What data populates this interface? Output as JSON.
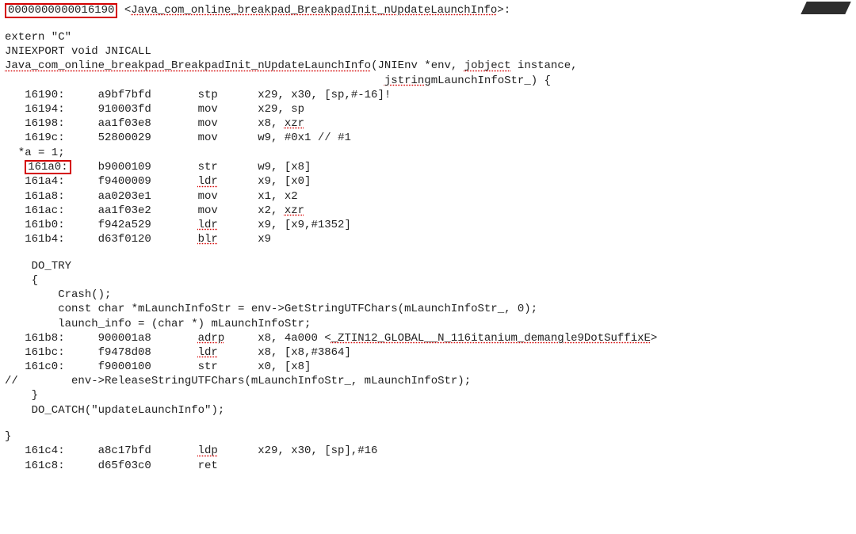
{
  "header": {
    "addr_boxed": "0000000000016190",
    "label_prefix": " <",
    "label": "Java_com_online_breakpad_BreakpadInit_nUpdateLaunchInfo",
    "label_suffix": ">:"
  },
  "decl": {
    "l1": "extern \"C\"",
    "l2": "JNIEXPORT void JNICALL",
    "fn": "Java_com_online_breakpad_BreakpadInit_nUpdateLaunchInfo",
    "args1_pre": "(JNIEnv *env, ",
    "args1_j": "jobject",
    "args1_post": " instance,",
    "args2_pre_spaces": "                                                         ",
    "args2_j": "jstring",
    "args2_post": " mLaunchInfoStr_) {"
  },
  "asm1": [
    {
      "addr": "16190:",
      "hex": "a9bf7bfd",
      "mnem": "stp",
      "ops": "x29, x30, [sp,#-16]!",
      "cmt": ""
    },
    {
      "addr": "16194:",
      "hex": "910003fd",
      "mnem": "mov",
      "ops": "x29, sp",
      "cmt": ""
    },
    {
      "addr": "16198:",
      "hex": "aa1f03e8",
      "mnem": "mov",
      "ops_pre": "x8, ",
      "ops_sq": "xzr",
      "ops_post": ""
    },
    {
      "addr": "1619c:",
      "hex": "52800029",
      "mnem": "mov",
      "ops": "w9, #0x1",
      "cmt": "                           // #1"
    }
  ],
  "src_a": "  *a = 1;",
  "boxed_addr2": "161a0:",
  "asm2first": {
    "hex": "b9000109",
    "mnem": "str",
    "ops": "w9, [x8]"
  },
  "asm2": [
    {
      "addr": "161a4:",
      "hex": "f9400009",
      "mnem_sq": "ldr",
      "ops": "x9, [x0]"
    },
    {
      "addr": "161a8:",
      "hex": "aa0203e1",
      "mnem": "mov",
      "ops": "x1, x2"
    },
    {
      "addr": "161ac:",
      "hex": "aa1f03e2",
      "mnem": "mov",
      "ops_pre": "x2, ",
      "ops_sq": "xzr",
      "ops_post": ""
    },
    {
      "addr": "161b0:",
      "hex": "f942a529",
      "mnem_sq": "ldr",
      "ops": "x9, [x9,#1352]"
    },
    {
      "addr": "161b4:",
      "hex": "d63f0120",
      "mnem_sq": "blr",
      "ops": "x9"
    }
  ],
  "mid": {
    "do_try": "    DO_TRY",
    "brace_open": "    {",
    "crash": "        Crash();",
    "line2": "        const char *mLaunchInfoStr = env->GetStringUTFChars(mLaunchInfoStr_, 0);",
    "line3": "        launch_info = (char *) mLaunchInfoStr;"
  },
  "asm3": [
    {
      "addr": "161b8:",
      "hex": "900001a8",
      "mnem_sq": "adrp",
      "ops_pre": "x8, 4a000 <",
      "ops_sq": "_ZTIN12_GLOBAL__N_116itanium_demangle9DotSuffixE",
      "ops_post": ">"
    },
    {
      "addr": "161bc:",
      "hex": "f9478d08",
      "mnem_sq": "ldr",
      "ops": "x8, [x8,#3864]"
    },
    {
      "addr": "161c0:",
      "hex": "f9000100",
      "mnem": "str",
      "ops": "x0, [x8]"
    }
  ],
  "tail": {
    "rel": "//        env->ReleaseStringUTFChars(mLaunchInfoStr_, mLaunchInfoStr);",
    "brace_close": "    }",
    "catch": "    DO_CATCH(\"updateLaunchInfo\");",
    "outer_close": "}"
  },
  "asm4": [
    {
      "addr": "161c4:",
      "hex": "a8c17bfd",
      "mnem_sq": "ldp",
      "ops": "x29, x30, [sp],#16"
    },
    {
      "addr": "161c8:",
      "hex": "d65f03c0",
      "mnem": "ret",
      "ops": ""
    }
  ]
}
